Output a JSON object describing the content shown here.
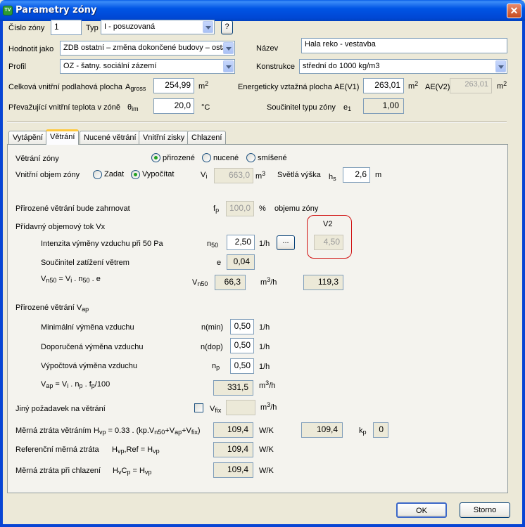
{
  "window": {
    "title": "Parametry zóny",
    "app_icon": "TV"
  },
  "header": {
    "cislo_zony_label": "Číslo zóny",
    "cislo_zony_value": "1",
    "typ_label": "Typ",
    "typ_value": "I - posuzovaná",
    "help_label": "?",
    "hodnotit_label": "Hodnotit jako",
    "hodnotit_value": "ZDB ostatní – změna dokončené budovy – ostat",
    "nazev_label": "Název",
    "nazev_value": "Hala reko - vestavba",
    "profil_label": "Profil",
    "profil_value": "OZ - šatny. sociální zázemí",
    "konstrukce_label": "Konstrukce",
    "konstrukce_value": "střední do 1000 kg/m3",
    "plocha_label": "Celková vnitřní podlahová plocha",
    "plocha_sym": "A",
    "plocha_sub": "gross",
    "plocha_value": "254,99",
    "plocha_unit": "m",
    "plocha_unit_sup": "2",
    "energ_label": "Energeticky vztažná plocha",
    "ae1_label": "AE(V1)",
    "ae1_value": "263,01",
    "ae1_unit": "m",
    "ae1_unit_sup": "2",
    "ae2_label": "AE(V2)",
    "ae2_value": "263,01",
    "ae2_unit": "m",
    "ae2_unit_sup": "2",
    "teplota_label": "Převažující vnitřní teplota v zóně",
    "teplota_sym": "θ",
    "teplota_sub": "im",
    "teplota_value": "20,0",
    "teplota_unit": "°C",
    "soucinitel_typu_label": "Součinitel typu zóny",
    "e1_sym": "e",
    "e1_sub": "1",
    "e1_value": "1,00"
  },
  "tabs": [
    {
      "label": "Vytápění",
      "active": false
    },
    {
      "label": "Větrání",
      "active": true
    },
    {
      "label": "Nucené větrání",
      "active": false
    },
    {
      "label": "Vnitřní zisky",
      "active": false
    },
    {
      "label": "Chlazení",
      "active": false
    }
  ],
  "vetrani": {
    "zony_label": "Větrání zóny",
    "opt_prirozene": "přirozené",
    "opt_nucene": "nucené",
    "opt_smisene": "smíšené",
    "objem_label": "Vnitřní objem zóny",
    "opt_zadat": "Zadat",
    "opt_vypocitat": "Vypočítat",
    "vi_sym": "V",
    "vi_sub": "i",
    "vi_value": "663,0",
    "vi_unit": "m",
    "vi_unit_sup": "3",
    "svetla_label": "Světlá výška",
    "hs_sym": "h",
    "hs_sub": "s",
    "hs_value": "2,6",
    "hs_unit": "m",
    "zahrnovat_label": "Přirozené větrání bude zahrnovat",
    "fp_sym": "f",
    "fp_sub": "p",
    "fp_value": "100,0",
    "fp_unit": "%",
    "fp_after": "objemu zóny",
    "pridavny_label": "Přídavný objemový tok Vx",
    "v2_label": "V2",
    "intenzita_label": "Intenzita výměny vzduchu při 50 Pa",
    "n50_sym": "n",
    "n50_sub": "50",
    "n50_value": "2,50",
    "n50_unit": "1/h",
    "dots_label": "...",
    "v2_value": "4,50",
    "soucinitel_label": "Součinitel zatížení větrem",
    "e_sym": "e",
    "e_value": "0,04",
    "vn50_formula": "V",
    "vn50_formula_sub": "n50",
    "vn50_formula_rest": " = V",
    "vn50_formula_sub2": "i",
    "vn50_formula_rest2": " . n",
    "vn50_formula_sub3": "50",
    "vn50_formula_rest3": " . e",
    "vn50_sym": "V",
    "vn50_sub": "n50",
    "vn50_value": "66,3",
    "vn50_unit": "m",
    "vn50_unit_sup": "3",
    "vn50_unit_rest": "/h",
    "vn50_v2_value": "119,3",
    "vap_title": "Přirozené větrání V",
    "vap_title_sub": "ap",
    "min_label": "Minimální výměna vzduchu",
    "min_sym": "n(min)",
    "min_value": "0,50",
    "min_unit": "1/h",
    "dop_label": "Doporučená výměna vzduchu",
    "dop_sym": "n(dop)",
    "dop_value": "0,50",
    "dop_unit": "1/h",
    "vyp_label": "Výpočtová výměna vzduchu",
    "np_sym": "n",
    "np_sub": "p",
    "np_value": "0,50",
    "np_unit": "1/h",
    "vap_formula": "V",
    "vap_formula_sub": "ap",
    "vap_formula_rest": " = V",
    "vap_formula_sub2": "i",
    "vap_formula_rest2": " . n",
    "vap_formula_sub3": "p",
    "vap_formula_rest3": " . f",
    "vap_formula_sub4": "p",
    "vap_formula_rest4": "/100",
    "vap_value": "331,5",
    "vap_unit": "m",
    "vap_unit_sup": "3",
    "vap_unit_rest": "/h",
    "jiny_label": "Jiný požadavek na větrání",
    "vfix_sym": "V",
    "vfix_sub": "fix",
    "vfix_value": "",
    "vfix_unit": "m",
    "vfix_unit_sup": "3",
    "vfix_unit_rest": "/h",
    "merna_label": "Měrná ztráta větráním",
    "merna_formula": "H",
    "merna_formula_sub": "vp",
    "merna_formula_rest": " = 0.33 . (kp.V",
    "merna_formula_sub2": "n50",
    "merna_formula_rest2": "+V",
    "merna_formula_sub3": "ap",
    "merna_formula_rest3": "+V",
    "merna_formula_sub4": "fix",
    "merna_formula_rest4": ")",
    "merna_value": "109,4",
    "merna_unit": "W/K",
    "merna_v2_value": "109,4",
    "kp_sym": "k",
    "kp_sub": "p",
    "kp_value": "0",
    "ref_label": "Referenční měrná ztráta",
    "ref_formula": "H",
    "ref_formula_sub": "vp",
    "ref_formula_rest": ",Ref = H",
    "ref_formula_sub2": "vp",
    "ref_value": "109,4",
    "ref_unit": "W/K",
    "chl_label": "Měrná ztráta při chlazení",
    "chl_formula": "H",
    "chl_formula_sub": "v",
    "chl_formula_rest": "C",
    "chl_formula_sub2": "p",
    "chl_formula_rest2": " = H",
    "chl_formula_sub3": "vp",
    "chl_value": "109,4",
    "chl_unit": "W/K"
  },
  "footer": {
    "ok_label": "OK",
    "storno_label": "Storno"
  }
}
